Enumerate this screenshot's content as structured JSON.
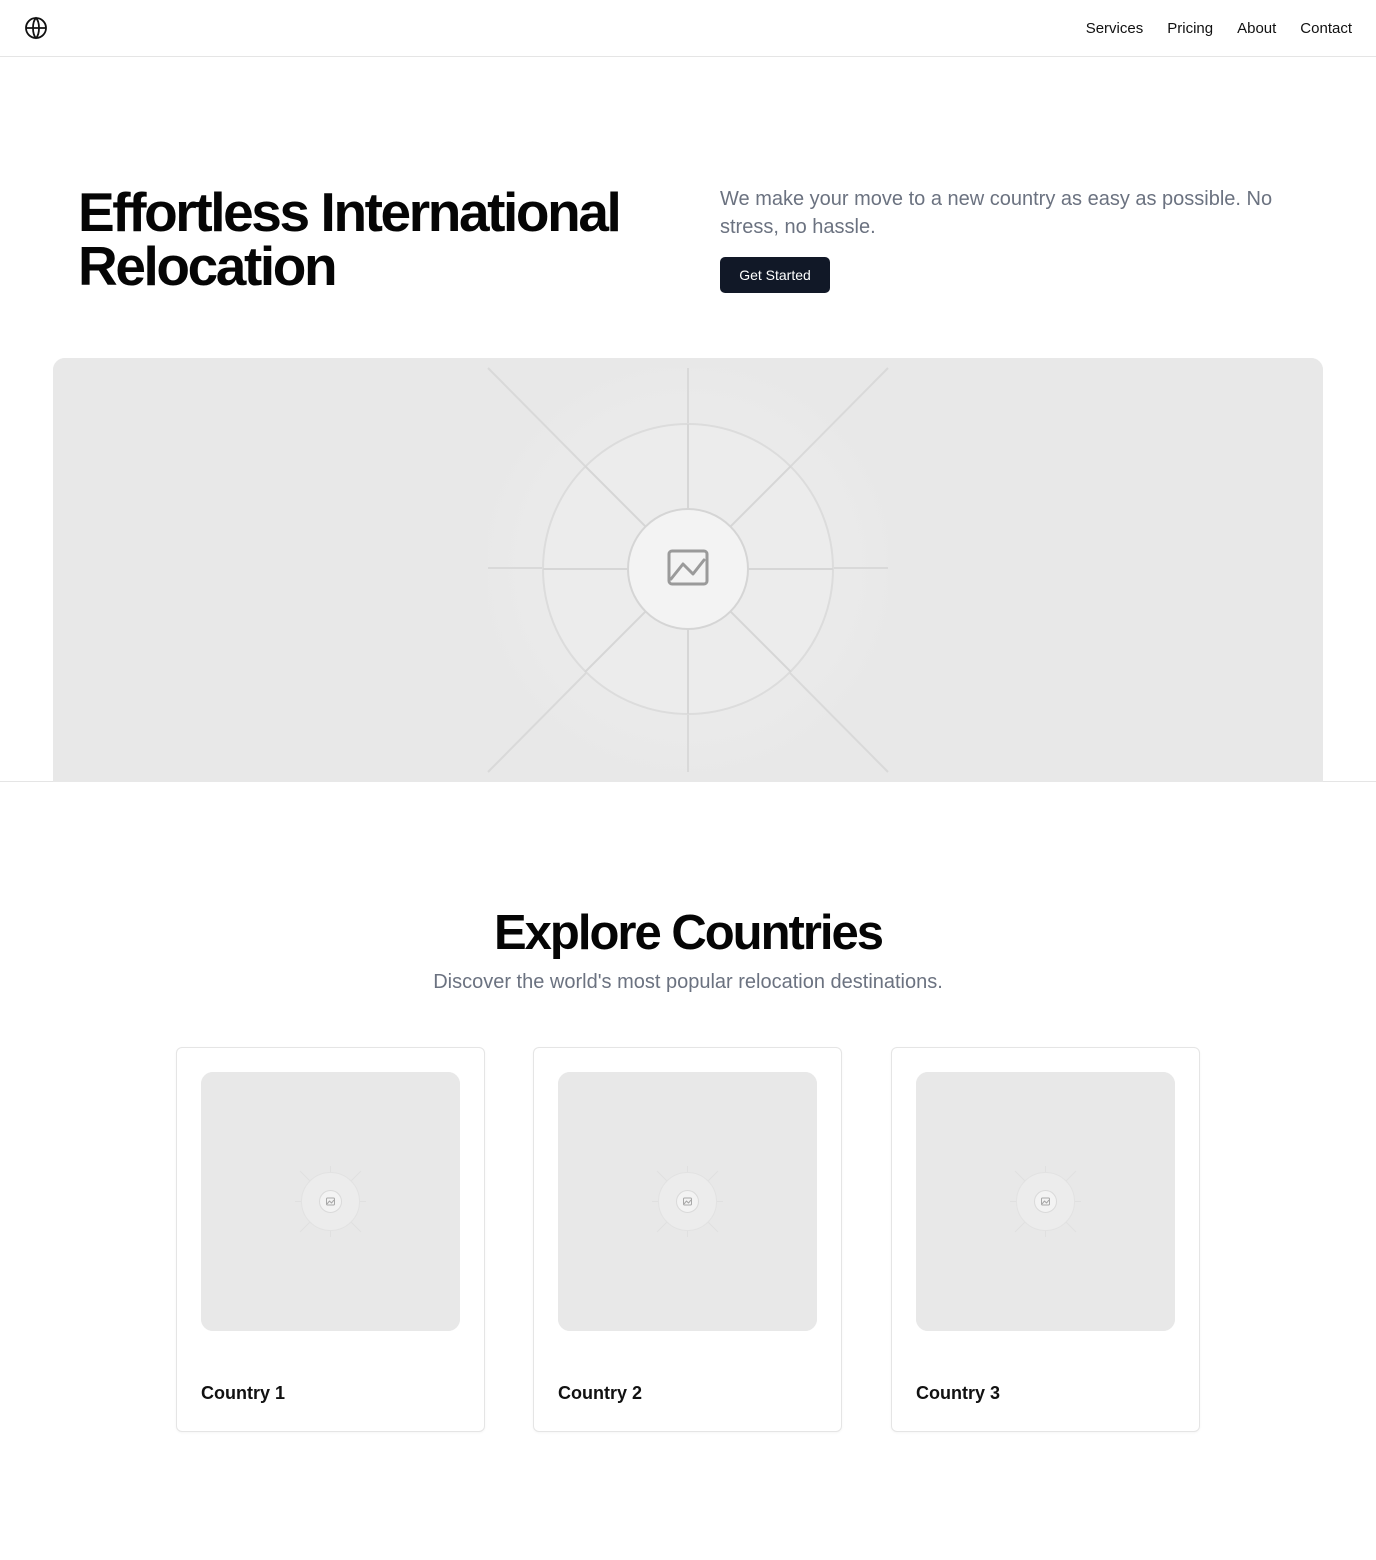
{
  "header": {
    "logo_icon": "globe-icon",
    "nav": [
      {
        "label": "Services"
      },
      {
        "label": "Pricing"
      },
      {
        "label": "About"
      },
      {
        "label": "Contact"
      }
    ]
  },
  "hero": {
    "title": "Effortless International Relocation",
    "subtitle": "We make your move to a new country as easy as possible. No stress, no hassle.",
    "cta_label": "Get Started",
    "image_icon": "image-placeholder-icon"
  },
  "explore": {
    "title": "Explore Countries",
    "subtitle": "Discover the world's most popular relocation destinations.",
    "cards": [
      {
        "title": "Country 1",
        "image_icon": "image-placeholder-icon"
      },
      {
        "title": "Country 2",
        "image_icon": "image-placeholder-icon"
      },
      {
        "title": "Country 3",
        "image_icon": "image-placeholder-icon"
      }
    ]
  },
  "colors": {
    "primary_button": "#111827",
    "muted_text": "#6b7280",
    "placeholder_bg": "#e8e8e8",
    "border": "#e5e5e5"
  }
}
